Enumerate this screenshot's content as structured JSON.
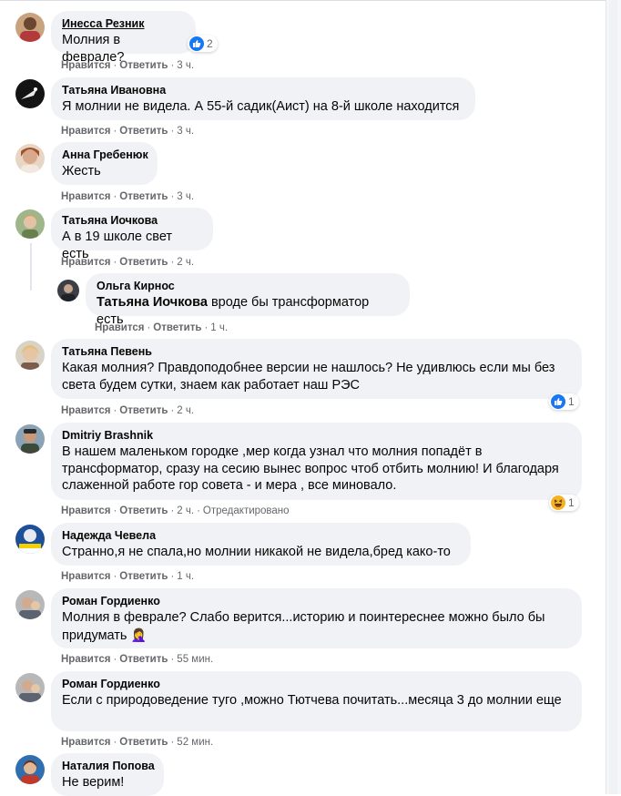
{
  "labels": {
    "like": "Нравится",
    "reply": "Ответить",
    "dot": "·",
    "edited": "Отредактировано"
  },
  "colors": {
    "bubble_bg": "#f0f2f5",
    "meta_text": "#65676b",
    "like_blue": "#1877f2",
    "haha_yellow": "#f7b125"
  },
  "comments": [
    {
      "author": "Инесса Резник",
      "text": "Молния в феврале?",
      "time": "3 ч.",
      "reaction_icon": "like-icon",
      "reaction_count": "2"
    },
    {
      "author": "Татьяна Ивановна",
      "text": "Я молнии не видела. А 55-й садик(Аист) на 8-й школе находится",
      "time": "3 ч."
    },
    {
      "author": "Анна Гребенюк",
      "text": "Жесть",
      "time": "3 ч."
    },
    {
      "author": "Татьяна Иочкова",
      "text": "А в 19 школе свет есть",
      "time": "2 ч."
    },
    {
      "author": "Ольга Кирнос",
      "mention": "Татьяна Иочкова",
      "text": "вроде бы трансформатор есть",
      "time": "1 ч."
    },
    {
      "author": "Татьяна Певень",
      "text": "Какая молния? Правдоподобнее версии не нашлось? Не удивлюсь если мы без света будем сутки, знаем как работает наш РЭС",
      "time": "2 ч.",
      "reaction_icon": "like-icon",
      "reaction_count": "1"
    },
    {
      "author": "Dmitriy Brashnik",
      "text": "В нашем маленьком городке ,мер когда узнал что молния попадёт в трансформатор, сразу на сесию вынес вопрос чтоб отбить молнию! И благодаря слаженной работе гор совета - и мера , все миновало.",
      "time": "2 ч.",
      "edited": true,
      "reaction_icon": "haha-icon",
      "reaction_count": "1"
    },
    {
      "author": "Надежда Чевела",
      "text": "Странно,я не спала,но молнии никакой не видела,бред како-то",
      "time": "1 ч."
    },
    {
      "author": "Роман Гордиенко",
      "text": "Молния в феврале? Слабо верится...историю и поинтереснее можно было бы придумать",
      "text_emoji": "🤦‍♀️",
      "time": "55 мин."
    },
    {
      "author": "Роман Гордиенко",
      "text": "Если с природоведение туго ,можно Тютчева почитать...месяца 3 до молнии еще",
      "time": "52 мин."
    },
    {
      "author": "Наталия Попова",
      "text": "Не верим!",
      "time": ""
    }
  ]
}
